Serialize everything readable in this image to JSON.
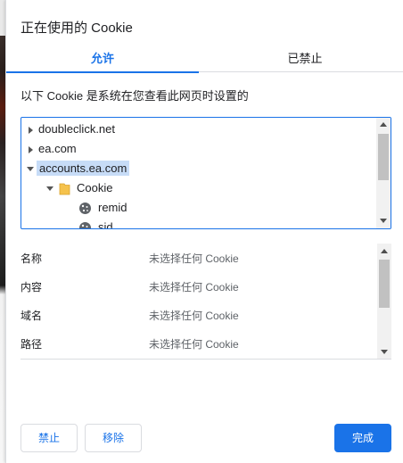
{
  "dialog": {
    "title": "正在使用的 Cookie",
    "tabs": [
      {
        "label": "允许",
        "active": true
      },
      {
        "label": "已禁止",
        "active": false
      }
    ],
    "description": "以下 Cookie 是系统在您查看此网页时设置的"
  },
  "tree": {
    "items": [
      {
        "label": "doubleclick.net",
        "type": "site",
        "expanded": false
      },
      {
        "label": "ea.com",
        "type": "site",
        "expanded": false
      },
      {
        "label": "accounts.ea.com",
        "type": "site",
        "expanded": true,
        "selected": true
      },
      {
        "label": "Cookie",
        "type": "folder",
        "expanded": true
      },
      {
        "label": "remid",
        "type": "cookie"
      },
      {
        "label": "sid",
        "type": "cookie"
      }
    ]
  },
  "details": {
    "rows": [
      {
        "label": "名称",
        "value": "未选择任何 Cookie"
      },
      {
        "label": "内容",
        "value": "未选择任何 Cookie"
      },
      {
        "label": "域名",
        "value": "未选择任何 Cookie"
      },
      {
        "label": "路径",
        "value": "未选择任何 Cookie"
      }
    ]
  },
  "buttons": {
    "block": "禁止",
    "remove": "移除",
    "done": "完成"
  },
  "colors": {
    "accent": "#1a73e8",
    "selection": "#c7dcf7",
    "folder": "#f5c24c"
  },
  "icons": [
    "expand-arrow-icon",
    "collapse-arrow-icon",
    "folder-icon",
    "cookie-icon"
  ]
}
